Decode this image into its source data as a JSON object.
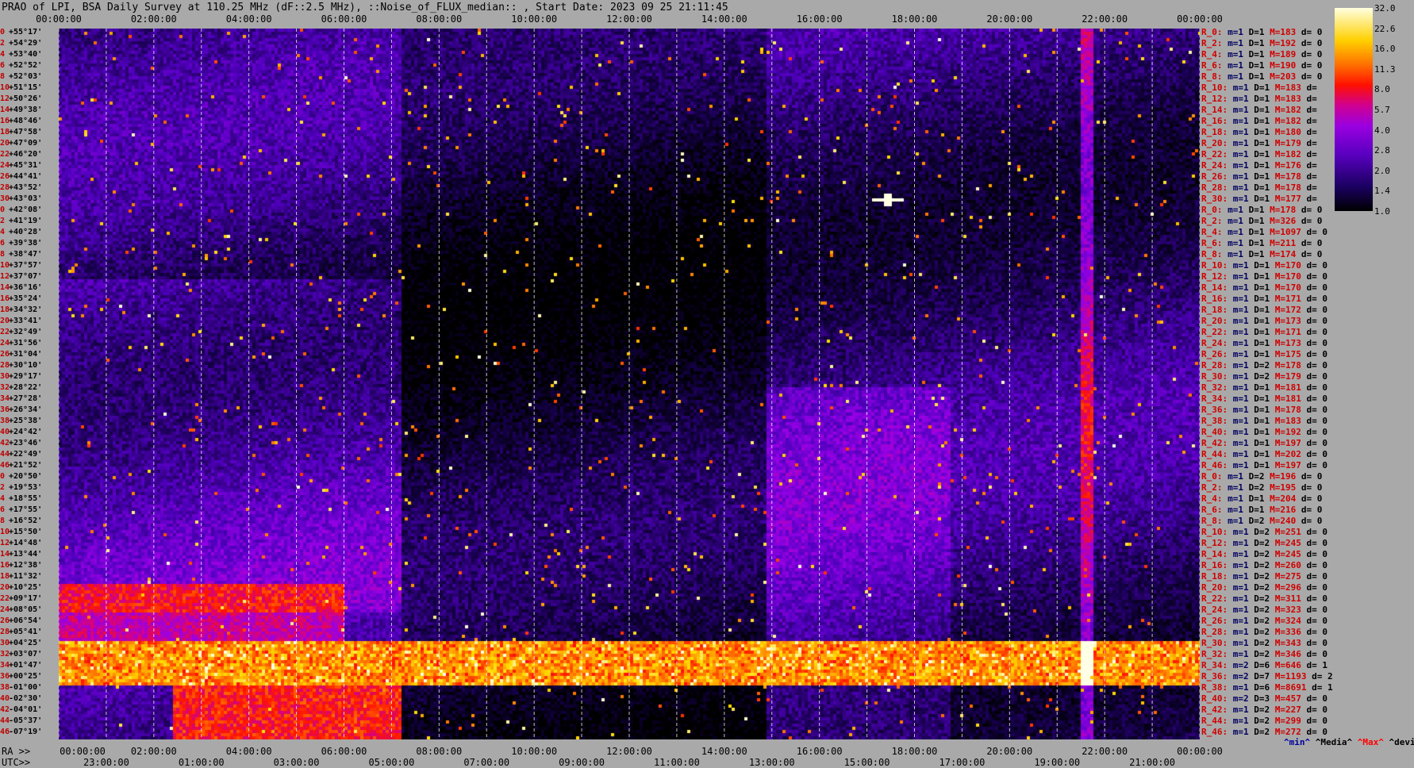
{
  "title": "PRAO of LPI, BSA Daily Survey at 110.25 MHz (dF::2.5 MHz), ::Noise_of_FLUX_median:: , Start Date: 2023 09 25 21:11:45",
  "axis_left_labels": {
    "ra": "RA >>",
    "utc": "UTC>>"
  },
  "top_time_ticks": [
    "00:00:00",
    "02:00:00",
    "04:00:00",
    "06:00:00",
    "08:00:00",
    "10:00:00",
    "12:00:00",
    "14:00:00",
    "16:00:00",
    "18:00:00",
    "20:00:00",
    "22:00:00",
    "00:00:00"
  ],
  "ra_bottom_ticks": [
    "00:00:00",
    "02:00:00",
    "04:00:00",
    "06:00:00",
    "08:00:00",
    "10:00:00",
    "12:00:00",
    "14:00:00",
    "16:00:00",
    "18:00:00",
    "20:00:00",
    "22:00:00",
    "00:00:00"
  ],
  "utc_bottom_ticks": [
    "23:00:00",
    "01:00:00",
    "03:00:00",
    "05:00:00",
    "07:00:00",
    "09:00:00",
    "11:00:00",
    "13:00:00",
    "15:00:00",
    "17:00:00",
    "19:00:00",
    "21:00:00"
  ],
  "dec_ticks": [
    {
      "n": "0",
      "v": "+55°17'"
    },
    {
      "n": "2",
      "v": "+54°29'"
    },
    {
      "n": "4",
      "v": "+53°40'"
    },
    {
      "n": "6",
      "v": "+52°52'"
    },
    {
      "n": "8",
      "v": "+52°03'"
    },
    {
      "n": "10",
      "v": "+51°15'"
    },
    {
      "n": "12",
      "v": "+50°26'"
    },
    {
      "n": "14",
      "v": "+49°38'"
    },
    {
      "n": "16",
      "v": "+48°46'"
    },
    {
      "n": "18",
      "v": "+47°58'"
    },
    {
      "n": "20",
      "v": "+47°09'"
    },
    {
      "n": "22",
      "v": "+46°20'"
    },
    {
      "n": "24",
      "v": "+45°31'"
    },
    {
      "n": "26",
      "v": "+44°41'"
    },
    {
      "n": "28",
      "v": "+43°52'"
    },
    {
      "n": "30",
      "v": "+43°03'"
    },
    {
      "n": "0",
      "v": "+42°08'"
    },
    {
      "n": "2",
      "v": "+41°19'"
    },
    {
      "n": "4",
      "v": "+40°28'"
    },
    {
      "n": "6",
      "v": "+39°38'"
    },
    {
      "n": "8",
      "v": "+38°47'"
    },
    {
      "n": "10",
      "v": "+37°57'"
    },
    {
      "n": "12",
      "v": "+37°07'"
    },
    {
      "n": "14",
      "v": "+36°16'"
    },
    {
      "n": "16",
      "v": "+35°24'"
    },
    {
      "n": "18",
      "v": "+34°32'"
    },
    {
      "n": "20",
      "v": "+33°41'"
    },
    {
      "n": "22",
      "v": "+32°49'"
    },
    {
      "n": "24",
      "v": "+31°56'"
    },
    {
      "n": "26",
      "v": "+31°04'"
    },
    {
      "n": "28",
      "v": "+30°10'"
    },
    {
      "n": "30",
      "v": "+29°17'"
    },
    {
      "n": "32",
      "v": "+28°22'"
    },
    {
      "n": "34",
      "v": "+27°28'"
    },
    {
      "n": "36",
      "v": "+26°34'"
    },
    {
      "n": "38",
      "v": "+25°38'"
    },
    {
      "n": "40",
      "v": "+24°42'"
    },
    {
      "n": "42",
      "v": "+23°46'"
    },
    {
      "n": "44",
      "v": "+22°49'"
    },
    {
      "n": "46",
      "v": "+21°52'"
    },
    {
      "n": "0",
      "v": "+20°50'"
    },
    {
      "n": "2",
      "v": "+19°53'"
    },
    {
      "n": "4",
      "v": "+18°55'"
    },
    {
      "n": "6",
      "v": "+17°55'"
    },
    {
      "n": "8",
      "v": "+16°52'"
    },
    {
      "n": "10",
      "v": "+15°50'"
    },
    {
      "n": "12",
      "v": "+14°48'"
    },
    {
      "n": "14",
      "v": "+13°44'"
    },
    {
      "n": "16",
      "v": "+12°38'"
    },
    {
      "n": "18",
      "v": "+11°32'"
    },
    {
      "n": "20",
      "v": "+10°25'"
    },
    {
      "n": "22",
      "v": "+09°17'"
    },
    {
      "n": "24",
      "v": "+08°05'"
    },
    {
      "n": "26",
      "v": "+06°54'"
    },
    {
      "n": "28",
      "v": "+05°41'"
    },
    {
      "n": "30",
      "v": "+04°25'"
    },
    {
      "n": "32",
      "v": "+03°07'"
    },
    {
      "n": "34",
      "v": "+01°47'"
    },
    {
      "n": "36",
      "v": "+00°25'"
    },
    {
      "n": "38",
      "v": "-01°00'"
    },
    {
      "n": "40",
      "v": "-02°30'"
    },
    {
      "n": "42",
      "v": "-04°01'"
    },
    {
      "n": "44",
      "v": "-05°37'"
    },
    {
      "n": "46",
      "v": "-07°19'"
    }
  ],
  "row_stats": [
    {
      "r": "R_0:",
      "m": "1",
      "D": "1",
      "M": "183",
      "d": "0"
    },
    {
      "r": "R_2:",
      "m": "1",
      "D": "1",
      "M": "192",
      "d": "0"
    },
    {
      "r": "R_4:",
      "m": "1",
      "D": "1",
      "M": "189",
      "d": "0"
    },
    {
      "r": "R_6:",
      "m": "1",
      "D": "1",
      "M": "190",
      "d": "0"
    },
    {
      "r": "R_8:",
      "m": "1",
      "D": "1",
      "M": "203",
      "d": "0"
    },
    {
      "r": "R_10:",
      "m": "1",
      "D": "1",
      "M": "183",
      "d": ""
    },
    {
      "r": "R_12:",
      "m": "1",
      "D": "1",
      "M": "183",
      "d": ""
    },
    {
      "r": "R_14:",
      "m": "1",
      "D": "1",
      "M": "182",
      "d": ""
    },
    {
      "r": "R_16:",
      "m": "1",
      "D": "1",
      "M": "182",
      "d": ""
    },
    {
      "r": "R_18:",
      "m": "1",
      "D": "1",
      "M": "180",
      "d": ""
    },
    {
      "r": "R_20:",
      "m": "1",
      "D": "1",
      "M": "179",
      "d": ""
    },
    {
      "r": "R_22:",
      "m": "1",
      "D": "1",
      "M": "182",
      "d": ""
    },
    {
      "r": "R_24:",
      "m": "1",
      "D": "1",
      "M": "176",
      "d": ""
    },
    {
      "r": "R_26:",
      "m": "1",
      "D": "1",
      "M": "178",
      "d": ""
    },
    {
      "r": "R_28:",
      "m": "1",
      "D": "1",
      "M": "178",
      "d": ""
    },
    {
      "r": "R_30:",
      "m": "1",
      "D": "1",
      "M": "177",
      "d": ""
    },
    {
      "r": "R_0:",
      "m": "1",
      "D": "1",
      "M": "178",
      "d": "0"
    },
    {
      "r": "R_2:",
      "m": "1",
      "D": "1",
      "M": "326",
      "d": "0"
    },
    {
      "r": "R_4:",
      "m": "1",
      "D": "1",
      "M": "1097",
      "d": "0"
    },
    {
      "r": "R_6:",
      "m": "1",
      "D": "1",
      "M": "211",
      "d": "0"
    },
    {
      "r": "R_8:",
      "m": "1",
      "D": "1",
      "M": "174",
      "d": "0"
    },
    {
      "r": "R_10:",
      "m": "1",
      "D": "1",
      "M": "170",
      "d": "0"
    },
    {
      "r": "R_12:",
      "m": "1",
      "D": "1",
      "M": "170",
      "d": "0"
    },
    {
      "r": "R_14:",
      "m": "1",
      "D": "1",
      "M": "170",
      "d": "0"
    },
    {
      "r": "R_16:",
      "m": "1",
      "D": "1",
      "M": "171",
      "d": "0"
    },
    {
      "r": "R_18:",
      "m": "1",
      "D": "1",
      "M": "172",
      "d": "0"
    },
    {
      "r": "R_20:",
      "m": "1",
      "D": "1",
      "M": "173",
      "d": "0"
    },
    {
      "r": "R_22:",
      "m": "1",
      "D": "1",
      "M": "171",
      "d": "0"
    },
    {
      "r": "R_24:",
      "m": "1",
      "D": "1",
      "M": "173",
      "d": "0"
    },
    {
      "r": "R_26:",
      "m": "1",
      "D": "1",
      "M": "175",
      "d": "0"
    },
    {
      "r": "R_28:",
      "m": "1",
      "D": "2",
      "M": "178",
      "d": "0"
    },
    {
      "r": "R_30:",
      "m": "1",
      "D": "2",
      "M": "179",
      "d": "0"
    },
    {
      "r": "R_32:",
      "m": "1",
      "D": "1",
      "M": "181",
      "d": "0"
    },
    {
      "r": "R_34:",
      "m": "1",
      "D": "1",
      "M": "181",
      "d": "0"
    },
    {
      "r": "R_36:",
      "m": "1",
      "D": "1",
      "M": "178",
      "d": "0"
    },
    {
      "r": "R_38:",
      "m": "1",
      "D": "1",
      "M": "183",
      "d": "0"
    },
    {
      "r": "R_40:",
      "m": "1",
      "D": "1",
      "M": "192",
      "d": "0"
    },
    {
      "r": "R_42:",
      "m": "1",
      "D": "1",
      "M": "197",
      "d": "0"
    },
    {
      "r": "R_44:",
      "m": "1",
      "D": "1",
      "M": "202",
      "d": "0"
    },
    {
      "r": "R_46:",
      "m": "1",
      "D": "1",
      "M": "197",
      "d": "0"
    },
    {
      "r": "R_0:",
      "m": "1",
      "D": "2",
      "M": "196",
      "d": "0"
    },
    {
      "r": "R_2:",
      "m": "1",
      "D": "2",
      "M": "195",
      "d": "0"
    },
    {
      "r": "R_4:",
      "m": "1",
      "D": "1",
      "M": "204",
      "d": "0"
    },
    {
      "r": "R_6:",
      "m": "1",
      "D": "1",
      "M": "216",
      "d": "0"
    },
    {
      "r": "R_8:",
      "m": "1",
      "D": "2",
      "M": "240",
      "d": "0"
    },
    {
      "r": "R_10:",
      "m": "1",
      "D": "2",
      "M": "251",
      "d": "0"
    },
    {
      "r": "R_12:",
      "m": "1",
      "D": "2",
      "M": "245",
      "d": "0"
    },
    {
      "r": "R_14:",
      "m": "1",
      "D": "2",
      "M": "245",
      "d": "0"
    },
    {
      "r": "R_16:",
      "m": "1",
      "D": "2",
      "M": "260",
      "d": "0"
    },
    {
      "r": "R_18:",
      "m": "1",
      "D": "2",
      "M": "275",
      "d": "0"
    },
    {
      "r": "R_20:",
      "m": "1",
      "D": "2",
      "M": "296",
      "d": "0"
    },
    {
      "r": "R_22:",
      "m": "1",
      "D": "2",
      "M": "311",
      "d": "0"
    },
    {
      "r": "R_24:",
      "m": "1",
      "D": "2",
      "M": "323",
      "d": "0"
    },
    {
      "r": "R_26:",
      "m": "1",
      "D": "2",
      "M": "324",
      "d": "0"
    },
    {
      "r": "R_28:",
      "m": "1",
      "D": "2",
      "M": "336",
      "d": "0"
    },
    {
      "r": "R_30:",
      "m": "1",
      "D": "2",
      "M": "343",
      "d": "0"
    },
    {
      "r": "R_32:",
      "m": "1",
      "D": "2",
      "M": "346",
      "d": "0"
    },
    {
      "r": "R_34:",
      "m": "2",
      "D": "6",
      "M": "646",
      "d": "1"
    },
    {
      "r": "R_36:",
      "m": "2",
      "D": "7",
      "M": "1193",
      "d": "2"
    },
    {
      "r": "R_38:",
      "m": "1",
      "D": "6",
      "M": "8691",
      "d": "1"
    },
    {
      "r": "R_40:",
      "m": "2",
      "D": "3",
      "M": "457",
      "d": "0"
    },
    {
      "r": "R_42:",
      "m": "1",
      "D": "2",
      "M": "227",
      "d": "0"
    },
    {
      "r": "R_44:",
      "m": "1",
      "D": "2",
      "M": "299",
      "d": "0"
    },
    {
      "r": "R_46:",
      "m": "1",
      "D": "2",
      "M": "272",
      "d": "0"
    }
  ],
  "legend": {
    "min": "^min^",
    "median": "^Media^",
    "max": "^Max^",
    "dev": "^devia^"
  },
  "colors": {
    "low": "#000000",
    "mid": "#8000e0",
    "high": "#ff2000",
    "peak": "#ffffff",
    "background": "#a9a9a9"
  },
  "chart_data": {
    "type": "heatmap",
    "title": "PRAO of LPI, BSA Daily Survey at 110.25 MHz (dF::2.5 MHz), ::Noise_of_FLUX_median:: , Start Date: 2023 09 25 21:11:45",
    "xlabel": "RA / UTC",
    "ylabel": "",
    "x_range_hours": [
      0,
      24
    ],
    "rows": 64,
    "colorbar_ticks": [
      "32.0",
      "22.6",
      "16.0",
      "11.3",
      "8.0",
      "5.7",
      "4.0",
      "2.8",
      "2.0",
      "1.4",
      "1.0"
    ],
    "colorbar_scale": "log",
    "grid": true
  }
}
